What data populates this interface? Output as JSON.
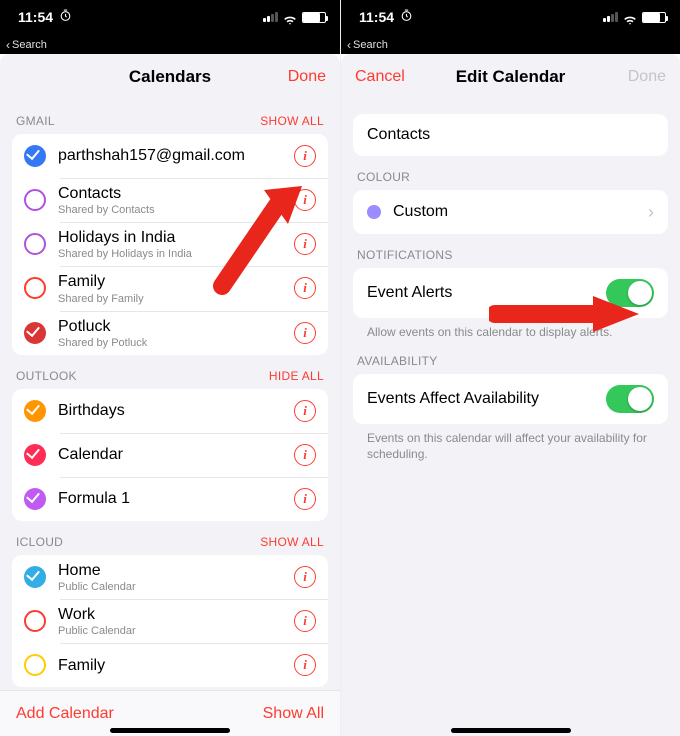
{
  "status": {
    "time": "11:54",
    "back_label": "Search"
  },
  "colors": {
    "accent": "#ff3b30",
    "switch_on": "#34c759",
    "blue": "#3478f6",
    "purple": "#af52de",
    "red": "#ff3b30",
    "deepred": "#d93636",
    "orange": "#ff9500",
    "pink": "#ff2d55",
    "violet": "#bf5af2",
    "teal": "#32ade6",
    "yellow": "#ffcc00",
    "lavender": "#9b8cff"
  },
  "left": {
    "title": "Calendars",
    "done": "Done",
    "sections": [
      {
        "header": "GMAIL",
        "action": "SHOW ALL",
        "items": [
          {
            "color": "blue",
            "checked": true,
            "label": "parthshah157@gmail.com",
            "sublabel": ""
          },
          {
            "color": "purple",
            "checked": false,
            "outline": true,
            "label": "Contacts",
            "sublabel": "Shared by Contacts"
          },
          {
            "color": "purple",
            "checked": false,
            "outline": true,
            "label": "Holidays in India",
            "sublabel": "Shared by Holidays in India"
          },
          {
            "color": "red",
            "checked": false,
            "outline": true,
            "label": "Family",
            "sublabel": "Shared by Family"
          },
          {
            "color": "deepred",
            "checked": true,
            "label": "Potluck",
            "sublabel": "Shared by Potluck"
          }
        ]
      },
      {
        "header": "OUTLOOK",
        "action": "HIDE ALL",
        "items": [
          {
            "color": "orange",
            "checked": true,
            "label": "Birthdays",
            "sublabel": ""
          },
          {
            "color": "pink",
            "checked": true,
            "label": "Calendar",
            "sublabel": ""
          },
          {
            "color": "violet",
            "checked": true,
            "label": "Formula 1",
            "sublabel": ""
          }
        ]
      },
      {
        "header": "ICLOUD",
        "action": "SHOW ALL",
        "items": [
          {
            "color": "teal",
            "checked": true,
            "label": "Home",
            "sublabel": "Public Calendar"
          },
          {
            "color": "red",
            "checked": false,
            "outline": true,
            "label": "Work",
            "sublabel": "Public Calendar"
          },
          {
            "color": "yellow",
            "checked": false,
            "outline": true,
            "label": "Family",
            "sublabel": ""
          }
        ]
      }
    ],
    "toolbar": {
      "add": "Add Calendar",
      "showall": "Show All"
    }
  },
  "right": {
    "cancel": "Cancel",
    "title": "Edit Calendar",
    "done": "Done",
    "name_value": "Contacts",
    "colour_header": "COLOUR",
    "colour_value": "Custom",
    "notifications_header": "NOTIFICATIONS",
    "event_alerts_label": "Event Alerts",
    "event_alerts_on": true,
    "event_alerts_footer": "Allow events on this calendar to display alerts.",
    "availability_header": "AVAILABILITY",
    "availability_label": "Events Affect Availability",
    "availability_on": true,
    "availability_footer": "Events on this calendar will affect your availability for scheduling."
  }
}
